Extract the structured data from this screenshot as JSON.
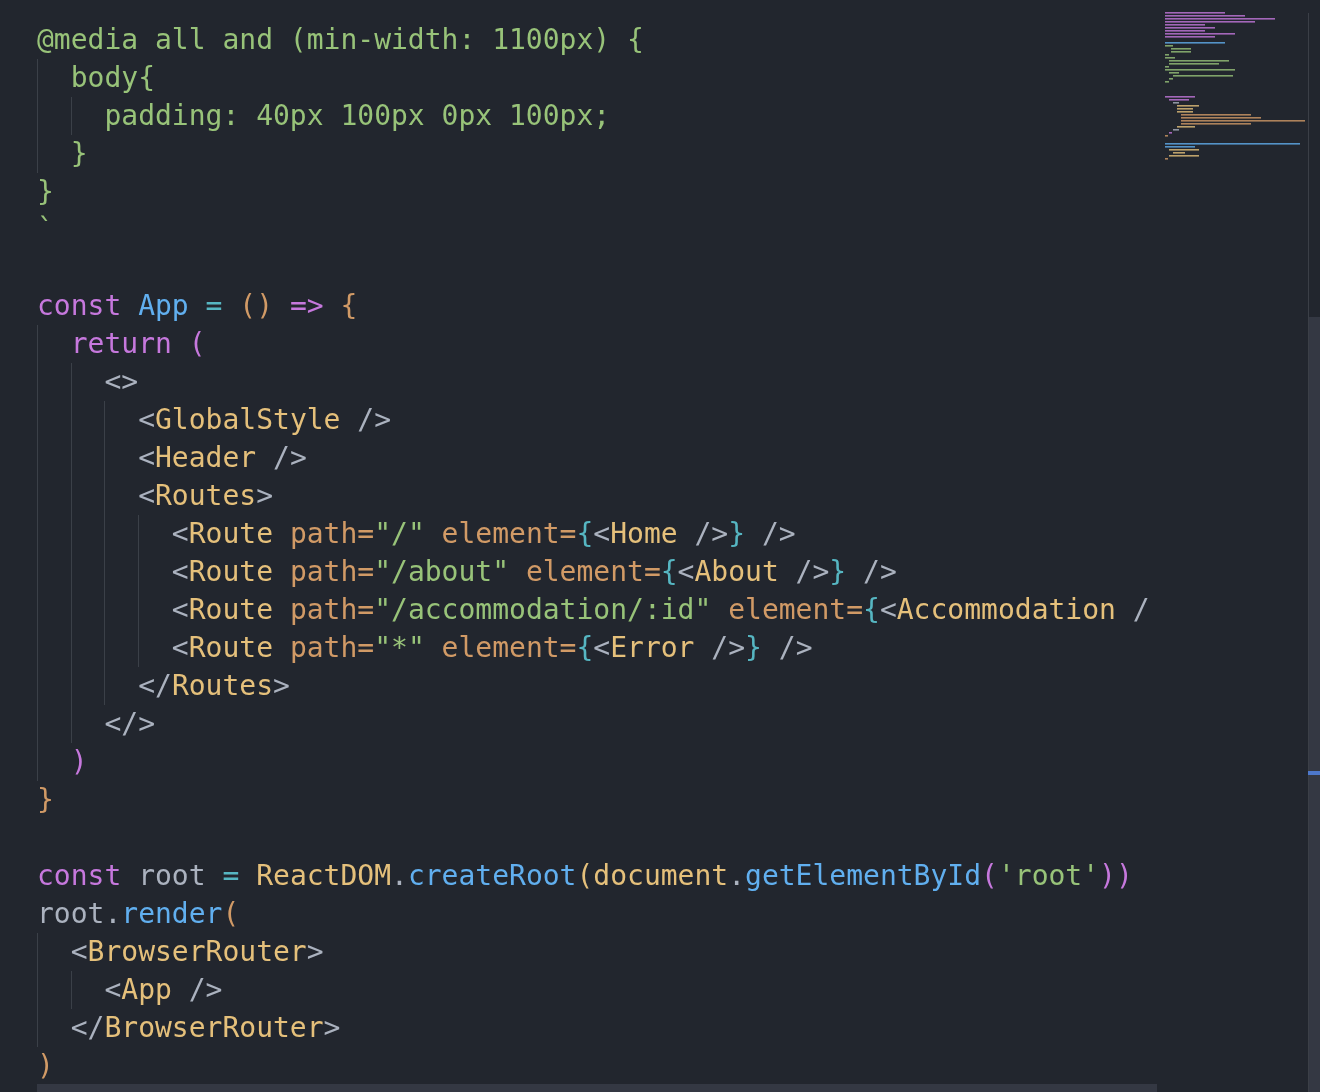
{
  "editor": {
    "lines": [
      {
        "tokens": [
          {
            "text": "@media all and (min-width: 1100px) {",
            "kind": "str"
          }
        ]
      },
      {
        "tokens": [
          {
            "text": "  body{",
            "kind": "str"
          }
        ]
      },
      {
        "tokens": [
          {
            "text": "    padding: 40px 100px 0px 100px;",
            "kind": "str"
          }
        ]
      },
      {
        "tokens": [
          {
            "text": "  }",
            "kind": "str"
          }
        ]
      },
      {
        "tokens": [
          {
            "text": "}",
            "kind": "str"
          }
        ]
      },
      {
        "tokens": [
          {
            "text": "`",
            "kind": "str"
          }
        ]
      },
      {
        "space_before": true,
        "tokens": [
          {
            "text": "const ",
            "kind": "kw"
          },
          {
            "text": "App",
            "kind": "fn"
          },
          {
            "text": " = ",
            "kind": "op"
          },
          {
            "text": "()",
            "kind": "br"
          },
          {
            "text": " => ",
            "kind": "kw"
          },
          {
            "text": "{",
            "kind": "br"
          }
        ]
      },
      {
        "tokens": [
          {
            "text": "  return (",
            "kind": "kw"
          }
        ]
      },
      {
        "tokens": [
          {
            "text": "    <>",
            "kind": "pun"
          }
        ]
      },
      {
        "tokens": [
          {
            "text": "      <",
            "kind": "pun"
          },
          {
            "text": "GlobalStyle",
            "kind": "typ"
          },
          {
            "text": " />",
            "kind": "pun"
          }
        ]
      },
      {
        "tokens": [
          {
            "text": "      <",
            "kind": "pun"
          },
          {
            "text": "Header",
            "kind": "typ"
          },
          {
            "text": " />",
            "kind": "pun"
          }
        ]
      },
      {
        "tokens": [
          {
            "text": "      <",
            "kind": "pun"
          },
          {
            "text": "Routes",
            "kind": "typ"
          },
          {
            "text": ">",
            "kind": "pun"
          }
        ]
      },
      {
        "tokens": [
          {
            "text": "        <",
            "kind": "pun"
          },
          {
            "text": "Route ",
            "kind": "typ"
          },
          {
            "text": "path=",
            "kind": "attr"
          },
          {
            "text": "\"/\" ",
            "kind": "str"
          },
          {
            "text": "element=",
            "kind": "attr"
          },
          {
            "text": "{",
            "kind": "cy"
          },
          {
            "text": "<",
            "kind": "pun"
          },
          {
            "text": "Home",
            "kind": "typ"
          },
          {
            "text": " />",
            "kind": "pun"
          },
          {
            "text": "}",
            "kind": "cy"
          },
          {
            "text": " />",
            "kind": "pun"
          }
        ]
      },
      {
        "tokens": [
          {
            "text": "        <",
            "kind": "pun"
          },
          {
            "text": "Route ",
            "kind": "typ"
          },
          {
            "text": "path=",
            "kind": "attr"
          },
          {
            "text": "\"/about\" ",
            "kind": "str"
          },
          {
            "text": "element=",
            "kind": "attr"
          },
          {
            "text": "{",
            "kind": "cy"
          },
          {
            "text": "<",
            "kind": "pun"
          },
          {
            "text": "About",
            "kind": "typ"
          },
          {
            "text": " />",
            "kind": "pun"
          },
          {
            "text": "}",
            "kind": "cy"
          },
          {
            "text": " />",
            "kind": "pun"
          }
        ]
      },
      {
        "tokens": [
          {
            "text": "        <",
            "kind": "pun"
          },
          {
            "text": "Route ",
            "kind": "typ"
          },
          {
            "text": "path=",
            "kind": "attr"
          },
          {
            "text": "\"/accommodation/:id\" ",
            "kind": "str"
          },
          {
            "text": "element=",
            "kind": "attr"
          },
          {
            "text": "{",
            "kind": "cy"
          },
          {
            "text": "<",
            "kind": "pun"
          },
          {
            "text": "Accommodation",
            "kind": "typ"
          },
          {
            "text": " /",
            "kind": "pun"
          }
        ]
      },
      {
        "tokens": [
          {
            "text": "        <",
            "kind": "pun"
          },
          {
            "text": "Route ",
            "kind": "typ"
          },
          {
            "text": "path=",
            "kind": "attr"
          },
          {
            "text": "\"*\" ",
            "kind": "str"
          },
          {
            "text": "element=",
            "kind": "attr"
          },
          {
            "text": "{",
            "kind": "cy"
          },
          {
            "text": "<",
            "kind": "pun"
          },
          {
            "text": "Error",
            "kind": "typ"
          },
          {
            "text": " />",
            "kind": "pun"
          },
          {
            "text": "}",
            "kind": "cy"
          },
          {
            "text": " />",
            "kind": "pun"
          }
        ]
      },
      {
        "tokens": [
          {
            "text": "      </",
            "kind": "pun"
          },
          {
            "text": "Routes",
            "kind": "typ"
          },
          {
            "text": ">",
            "kind": "pun"
          }
        ]
      },
      {
        "tokens": [
          {
            "text": "    </>",
            "kind": "pun"
          }
        ]
      },
      {
        "tokens": [
          {
            "text": "  )",
            "kind": "kw"
          }
        ]
      },
      {
        "tokens": [
          {
            "text": "}",
            "kind": "br"
          }
        ]
      },
      {
        "space_before": true,
        "tokens": [
          {
            "text": "const ",
            "kind": "kw"
          },
          {
            "text": "root",
            "kind": "var"
          },
          {
            "text": " = ",
            "kind": "op"
          },
          {
            "text": "ReactDOM",
            "kind": "typ"
          },
          {
            "text": ".",
            "kind": "pun"
          },
          {
            "text": "createRoot",
            "kind": "fn"
          },
          {
            "text": "(document",
            "kind": "typ"
          },
          {
            "text": ".",
            "kind": "pun"
          },
          {
            "text": "getElementById",
            "kind": "fn"
          },
          {
            "text": "(",
            "kind": "kw"
          },
          {
            "text": "'root'",
            "kind": "str"
          },
          {
            "text": "))",
            "kind": "kw"
          }
        ]
      },
      {
        "tokens": [
          {
            "text": "root",
            "kind": "var"
          },
          {
            "text": ".",
            "kind": "pun"
          },
          {
            "text": "render",
            "kind": "fn"
          },
          {
            "text": "(",
            "kind": "br"
          }
        ]
      },
      {
        "tokens": [
          {
            "text": "  <",
            "kind": "pun"
          },
          {
            "text": "BrowserRouter",
            "kind": "typ"
          },
          {
            "text": ">",
            "kind": "pun"
          }
        ]
      },
      {
        "tokens": [
          {
            "text": "    <",
            "kind": "pun"
          },
          {
            "text": "App",
            "kind": "typ"
          },
          {
            "text": " />",
            "kind": "pun"
          }
        ]
      },
      {
        "tokens": [
          {
            "text": "  </",
            "kind": "pun"
          },
          {
            "text": "BrowserRouter",
            "kind": "typ"
          },
          {
            "text": ">",
            "kind": "pun"
          }
        ]
      },
      {
        "tokens": [
          {
            "text": ")",
            "kind": "br"
          }
        ]
      }
    ]
  }
}
